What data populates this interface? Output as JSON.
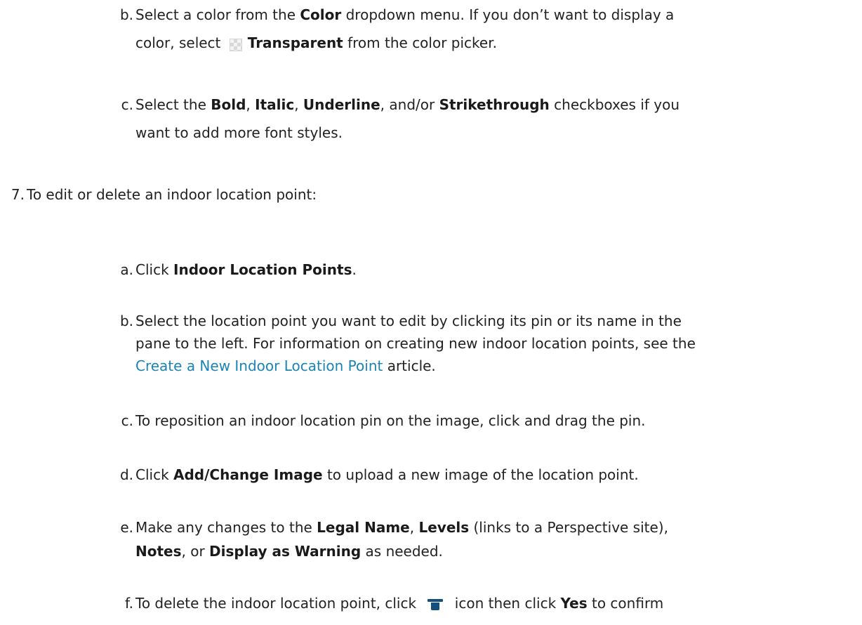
{
  "steps": {
    "b_color": {
      "marker": "b.",
      "line1_pre": "Select a color from the ",
      "line1_bold": "Color",
      "line1_post": " dropdown menu. If you don’t want to display a",
      "line2_pre": "color, select ",
      "line2_bold": "Transparent",
      "line2_post": " from the color picker."
    },
    "c_styles": {
      "marker": "c.",
      "pre": "Select the ",
      "bold1": "Bold",
      "sep1": ", ",
      "bold2": "Italic",
      "sep2": ", ",
      "bold3": "Underline",
      "sep3": ", and/or ",
      "bold4": "Strikethrough",
      "post": " checkboxes if you",
      "line2": "want to add more font styles."
    },
    "step7": {
      "marker": "7.",
      "text": "To edit or delete an indoor location point:"
    },
    "a_click": {
      "marker": "a.",
      "pre": "Click ",
      "bold": "Indoor Location Points",
      "post": "."
    },
    "b_select": {
      "marker": "b.",
      "line1": "Select the location point you want to edit by clicking its pin or its name in the",
      "line2": "pane to the left. For information on creating new indoor location points, see the",
      "link": "Create a New Indoor Location Point",
      "line3_post": " article."
    },
    "c_reposition": {
      "marker": "c.",
      "text": "To reposition an indoor location pin on the image, click and drag the pin."
    },
    "d_image": {
      "marker": "d.",
      "pre": "Click ",
      "bold": "Add/Change Image",
      "post": " to upload a new image of the location point."
    },
    "e_changes": {
      "marker": "e.",
      "pre": "Make any changes to the ",
      "bold1": "Legal Name",
      "sep1": ", ",
      "bold2": "Levels",
      "mid": " (links to a Perspective site),",
      "bold3": "Notes",
      "sep3": ", or ",
      "bold4": "Display as Warning",
      "post": " as needed."
    },
    "f_delete": {
      "marker": "f.",
      "pre": "To delete the indoor location point, click ",
      "icon": "trash-icon",
      "mid": " icon then click ",
      "bold": "Yes",
      "post": " to confirm"
    }
  }
}
